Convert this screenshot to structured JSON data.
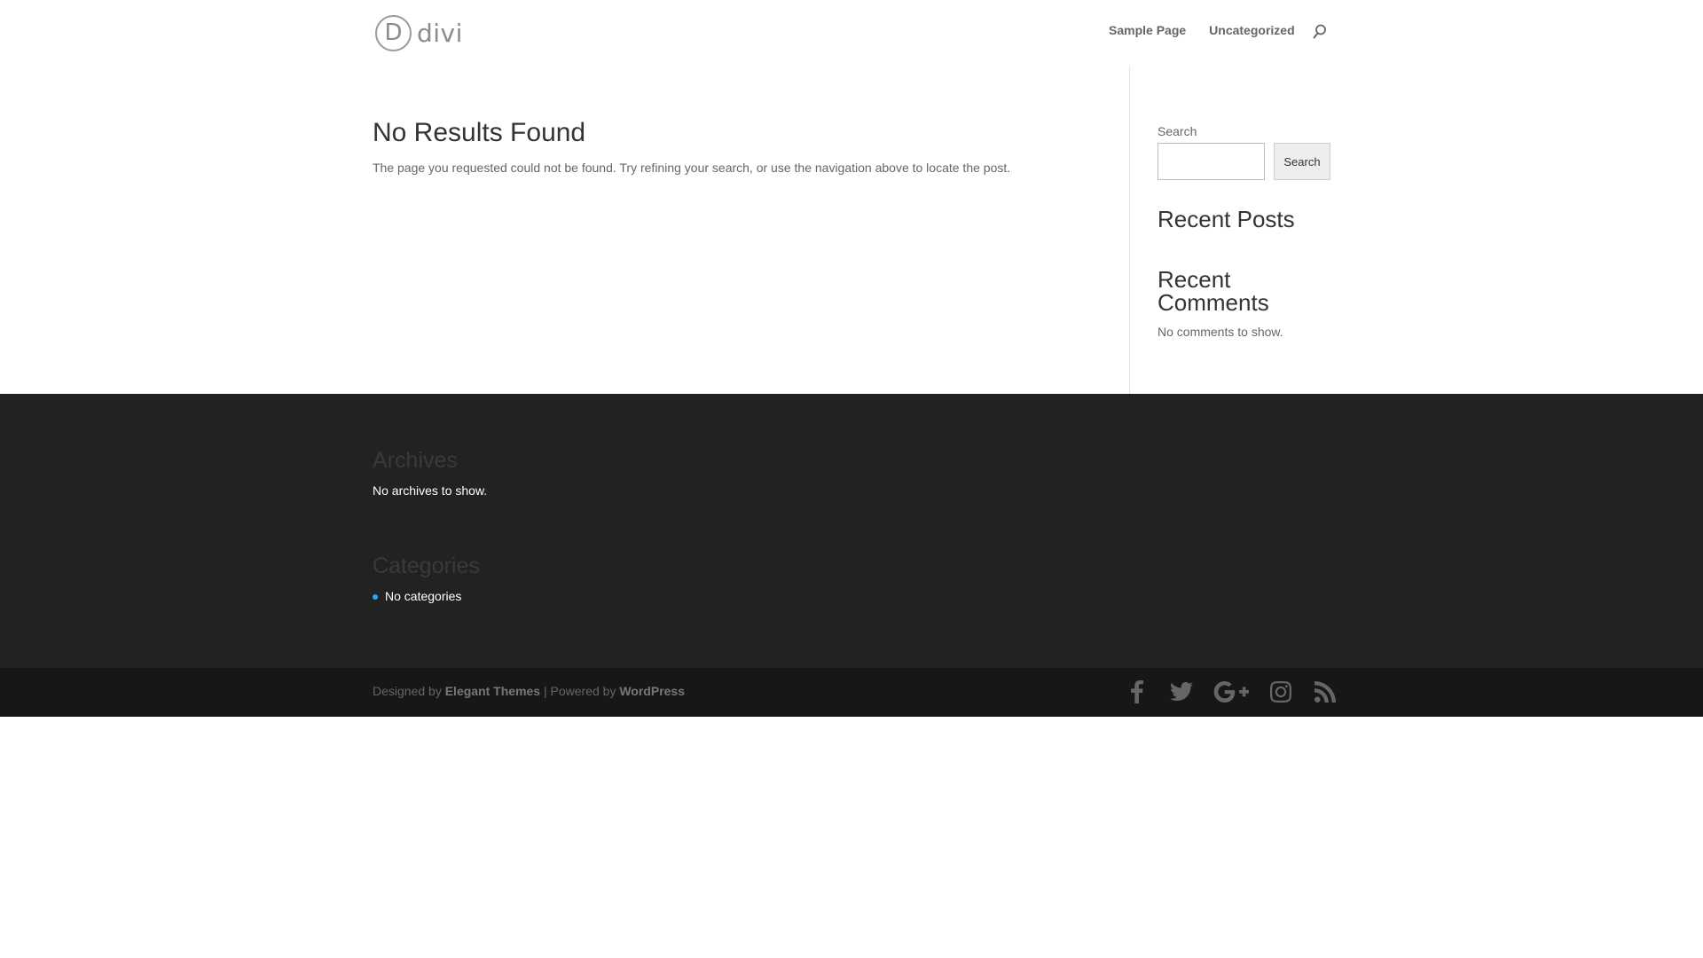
{
  "header": {
    "logo_letter": "D",
    "logo_word": "divi",
    "nav": [
      {
        "label": "Sample Page"
      },
      {
        "label": "Uncategorized"
      }
    ]
  },
  "content": {
    "title": "No Results Found",
    "message": "The page you requested could not be found. Try refining your search, or use the navigation above to locate the post."
  },
  "sidebar": {
    "search_label": "Search",
    "search_value": "",
    "search_button": "Search",
    "recent_posts_title": "Recent Posts",
    "recent_comments_title": "Recent Comments",
    "no_comments": "No comments to show."
  },
  "footer": {
    "archives_title": "Archives",
    "archives_empty": "No archives to show.",
    "categories_title": "Categories",
    "categories_empty": "No categories"
  },
  "credits": {
    "designed_by": "Designed by ",
    "elegant_themes": "Elegant Themes",
    "separator": " | Powered by ",
    "wordpress": "WordPress"
  },
  "social_icons": [
    "facebook-icon",
    "twitter-icon",
    "google-plus-icon",
    "instagram-icon",
    "rss-icon"
  ],
  "colors": {
    "accent": "#2ea3f2",
    "footer_bg": "#222222",
    "footer_bottom_bg": "#171717"
  }
}
